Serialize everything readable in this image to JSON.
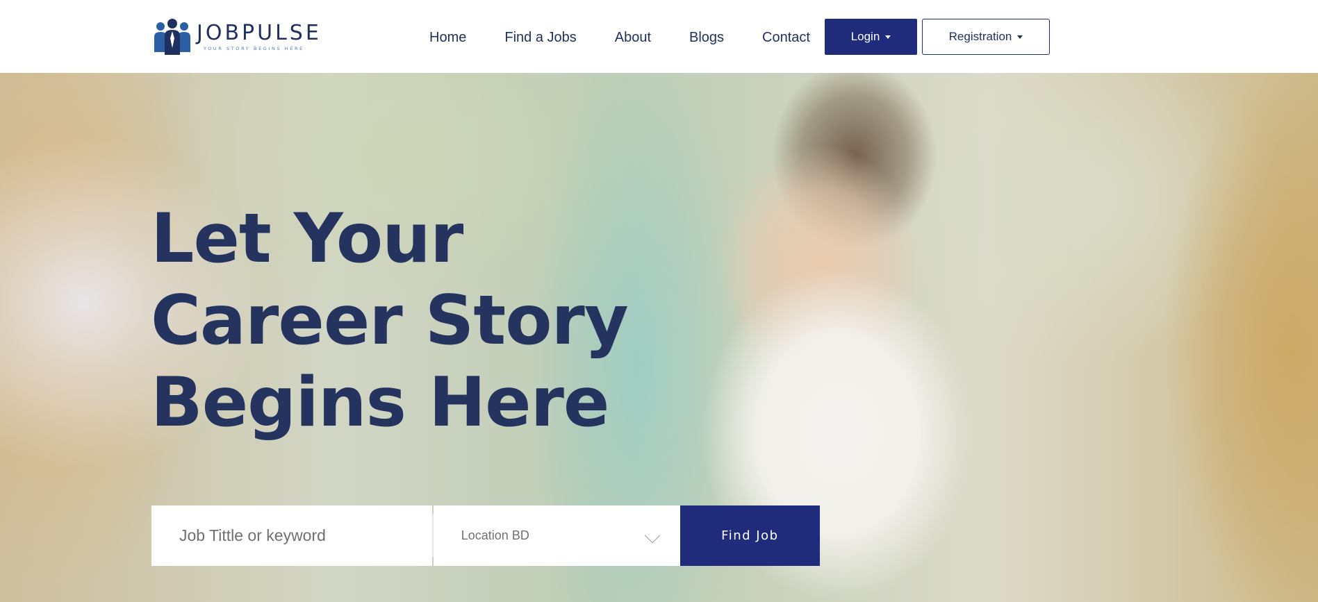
{
  "brand": {
    "name": "JOBPULSE",
    "tagline": "YOUR STORY BEGINS HERE",
    "primary_color": "#1f2b7b",
    "text_color": "#25345f"
  },
  "nav": {
    "items": [
      {
        "label": "Home"
      },
      {
        "label": "Find a Jobs"
      },
      {
        "label": "About"
      },
      {
        "label": "Blogs"
      },
      {
        "label": "Contact"
      }
    ],
    "login_label": "Login",
    "registration_label": "Registration"
  },
  "hero": {
    "headline_lines": [
      "Let Your",
      "Career Story",
      "Begins Here"
    ],
    "image": "woman-professional-smiling-photo"
  },
  "search": {
    "keyword_placeholder": "Job Tittle or keyword",
    "location_value": "Location BD",
    "submit_label": "Find Job"
  },
  "icons": {
    "logo_mark": "people-group-icon",
    "dropdown": "caret-down-icon",
    "select": "chevron-down-icon"
  }
}
